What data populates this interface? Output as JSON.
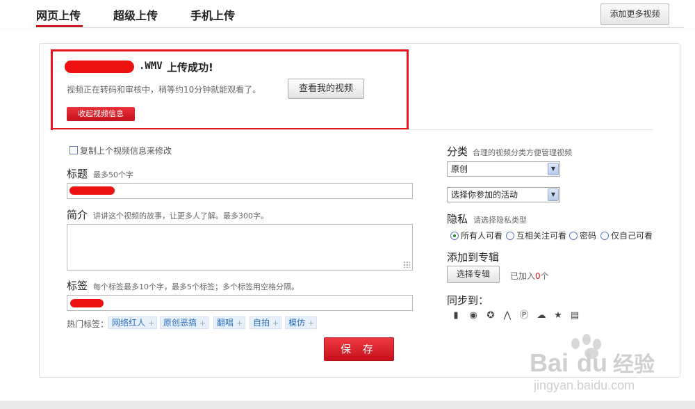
{
  "tabs": [
    {
      "label": "网页上传",
      "active": true
    },
    {
      "label": "超级上传",
      "active": false
    },
    {
      "label": "手机上传",
      "active": false
    }
  ],
  "add_more_button": "添加更多视频",
  "upload_result": {
    "file_ext": ".WMV",
    "success_text": "上传成功!",
    "transcode_msg": "视频正在转码和审核中，稍等约10分钟就能观看了。",
    "view_button": "查看我的视频",
    "collapse_button": "收起视频信息"
  },
  "form": {
    "copy_prev_label": "复制上个视频信息来修改",
    "title_label": "标题",
    "title_hint": "最多50个字",
    "desc_label": "简介",
    "desc_hint": "讲讲这个视频的故事，让更多人了解。最多300字。",
    "tags_label": "标签",
    "tags_hint": "每个标签最多10个字，最多5个标签；多个标签用空格分隔。",
    "hot_tags_label": "热门标签：",
    "hot_tags": [
      "网络红人",
      "原创恶搞",
      "翻唱",
      "自拍",
      "模仿"
    ],
    "save_button": "保 存"
  },
  "sidebar": {
    "category_label": "分类",
    "category_hint": "合理的视频分类方便管理视频",
    "category_value": "原创",
    "activity_value": "选择你参加的活动",
    "privacy_label": "隐私",
    "privacy_hint": "请选择隐私类型",
    "privacy_options": [
      "所有人可看",
      "互相关注可看",
      "密码",
      "仅自己可看"
    ],
    "privacy_selected": 0,
    "album_label": "添加到专辑",
    "album_button": "选择专辑",
    "album_added_prefix": "已加入",
    "album_added_count": "0",
    "album_added_suffix": "个",
    "sync_label": "同步到：",
    "sync_icons": [
      "blog-icon",
      "weibo-icon",
      "qzone-icon",
      "renren-icon",
      "douban-icon",
      "kaixin-icon",
      "sohu-icon",
      "netease-icon"
    ]
  },
  "watermark": {
    "brand": "Bai",
    "brand2": "du",
    "cn": "经验",
    "url": "jingyan.baidu.com"
  }
}
